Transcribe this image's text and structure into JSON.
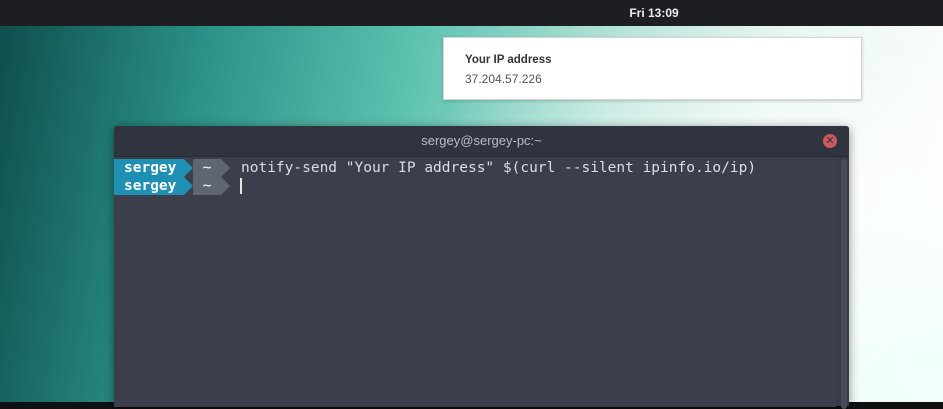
{
  "topbar": {
    "clock": "Fri 13:09"
  },
  "notification": {
    "title": "Your IP address",
    "body": "37.204.57.226"
  },
  "terminal": {
    "title": "sergey@sergey-pc:~",
    "close_icon": "close-icon",
    "lines": [
      {
        "user": "sergey",
        "dir": "~",
        "command": "notify-send \"Your IP address\" $(curl --silent ipinfo.io/ip)"
      },
      {
        "user": "sergey",
        "dir": "~",
        "command": ""
      }
    ]
  },
  "colors": {
    "prompt_user_bg": "#1f8fb3",
    "prompt_dir_bg": "#606670",
    "terminal_bg": "#383c4a",
    "close_button": "#cc575d"
  }
}
